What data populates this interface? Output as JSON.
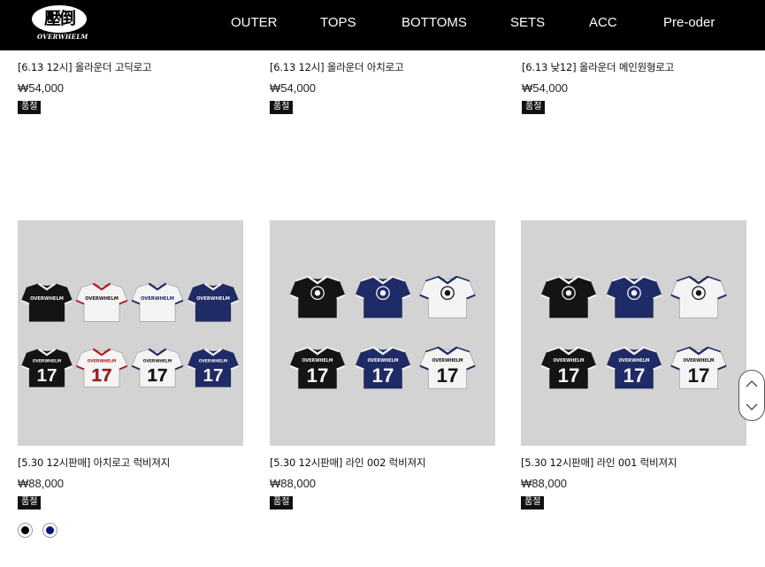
{
  "header": {
    "logo_mark": "壓倒",
    "logo_text": "OVERWHELM",
    "nav": [
      {
        "label": "OUTER"
      },
      {
        "label": "TOPS"
      },
      {
        "label": "BOTTOMS"
      },
      {
        "label": "SETS"
      },
      {
        "label": "ACC"
      },
      {
        "label": "Pre-oder"
      }
    ]
  },
  "products_top": [
    {
      "name": "[6.13 12시] 올라운더 고딕로고",
      "price": "₩54,000",
      "badge": "품절"
    },
    {
      "name": "[6.13 12시] 올라운더 아치로고",
      "price": "₩54,000",
      "badge": "품절"
    },
    {
      "name": "[6.13 낮12] 올라운더 메인원형로고",
      "price": "₩54,000",
      "badge": "품절"
    }
  ],
  "products_bottom": [
    {
      "name": "[5.30 12시판매] 아치로고 럭비져지",
      "price": "₩88,000",
      "badge": "품절",
      "colors": [
        "#000000",
        "#0a1580"
      ]
    },
    {
      "name": "[5.30 12시판매] 라인 002 럭비져지",
      "price": "₩88,000",
      "badge": "품절"
    },
    {
      "name": "[5.30 12시판매] 라인 001 럭비져지",
      "price": "₩88,000",
      "badge": "품절"
    }
  ],
  "jersey": {
    "print_text": "OVERWHELM",
    "number": "17",
    "colors": {
      "black": "#141414",
      "navy": "#1f2b66",
      "white": "#f4f4f4",
      "thumb_bg": "#d3d3d3",
      "red": "#b01a1a"
    }
  }
}
